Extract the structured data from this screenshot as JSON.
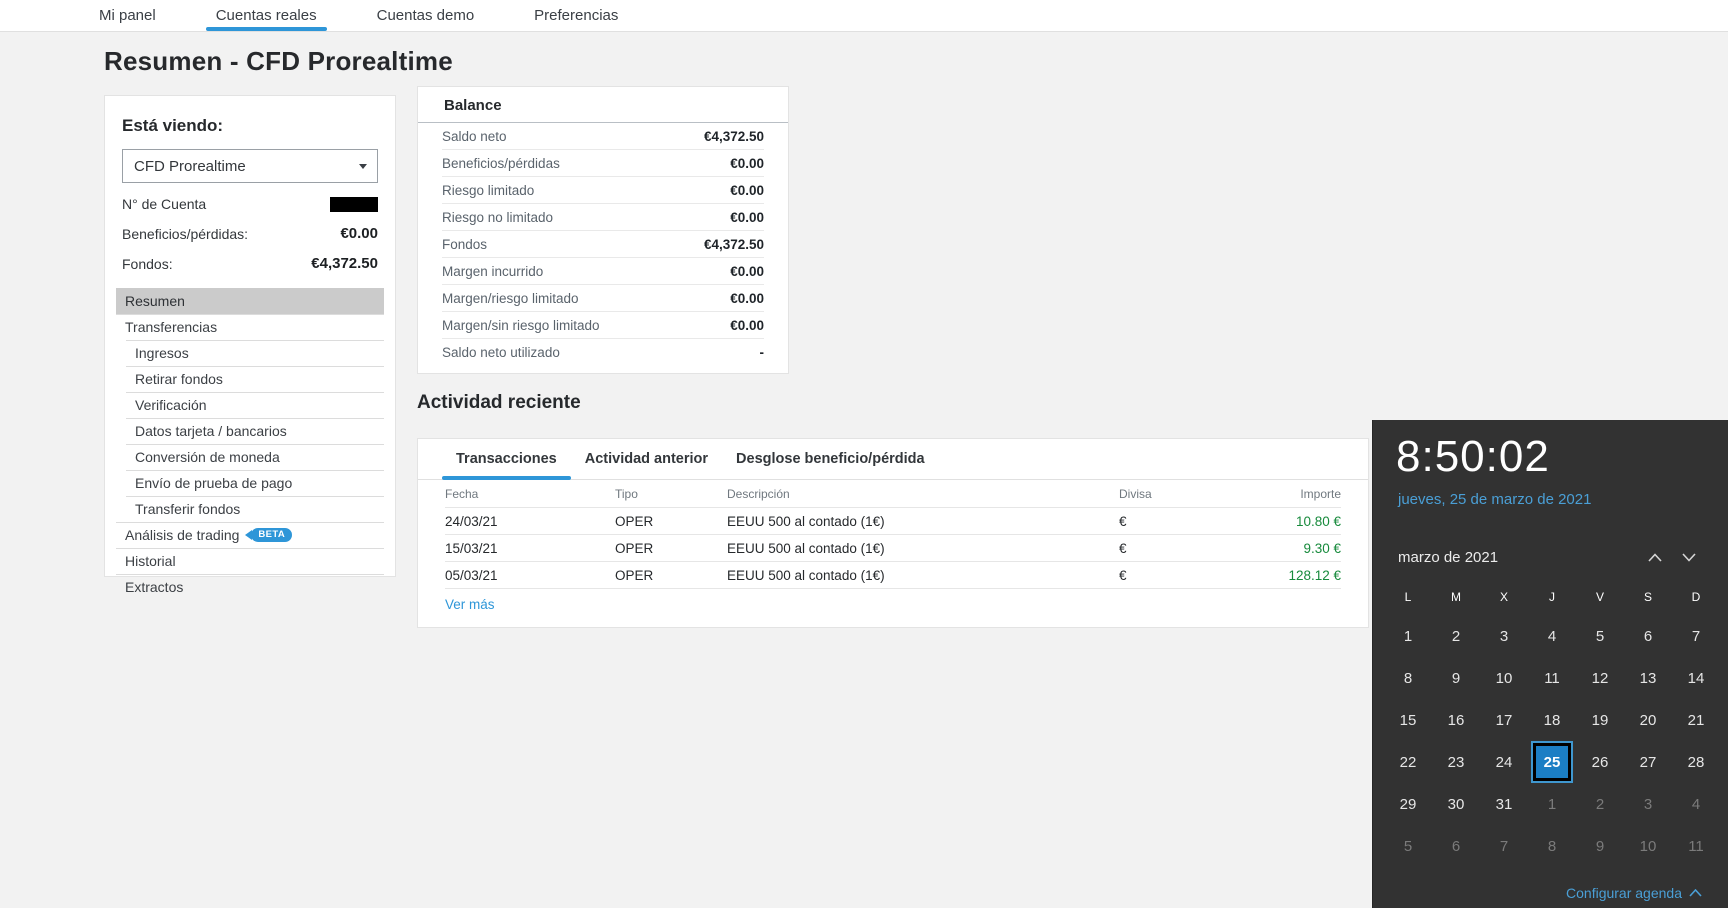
{
  "colors": {
    "accent": "#2e96d8",
    "positive": "#178a3c",
    "calendar_accent": "#4a9fd6",
    "calendar_selected_fill": "#1b7ec4",
    "sidebar_selected_bg": "#cbcbcb"
  },
  "nav": {
    "items": [
      {
        "label": "Mi panel",
        "active": false
      },
      {
        "label": "Cuentas reales",
        "active": true
      },
      {
        "label": "Cuentas demo",
        "active": false
      },
      {
        "label": "Preferencias",
        "active": false
      }
    ]
  },
  "page": {
    "title": "Resumen - CFD Prorealtime"
  },
  "account_panel": {
    "viewing_label": "Está viendo:",
    "account_select": "CFD Prorealtime",
    "account_number_label": "N° de Cuenta",
    "account_number_redacted": true,
    "pl_label": "Beneficios/pérdidas:",
    "pl_value": "€0.00",
    "funds_label": "Fondos:",
    "funds_value": "€4,372.50",
    "menu": [
      {
        "label": "Resumen",
        "selected": true,
        "sub": false
      },
      {
        "label": "Transferencias",
        "selected": false,
        "sub": false
      },
      {
        "label": "Ingresos",
        "selected": false,
        "sub": true
      },
      {
        "label": "Retirar fondos",
        "selected": false,
        "sub": true
      },
      {
        "label": "Verificación",
        "selected": false,
        "sub": true
      },
      {
        "label": "Datos tarjeta / bancarios",
        "selected": false,
        "sub": true
      },
      {
        "label": "Conversión de moneda",
        "selected": false,
        "sub": true
      },
      {
        "label": "Envío de prueba de pago",
        "selected": false,
        "sub": true
      },
      {
        "label": "Transferir fondos",
        "selected": false,
        "sub": true
      },
      {
        "label": "Análisis de trading",
        "selected": false,
        "sub": false,
        "badge": "BETA"
      },
      {
        "label": "Historial",
        "selected": false,
        "sub": false
      },
      {
        "label": "Extractos",
        "selected": false,
        "sub": false
      }
    ]
  },
  "balance": {
    "title": "Balance",
    "rows": [
      {
        "label": "Saldo neto",
        "value": "€4,372.50"
      },
      {
        "label": "Beneficios/pérdidas",
        "value": "€0.00"
      },
      {
        "label": "Riesgo limitado",
        "value": "€0.00"
      },
      {
        "label": "Riesgo no limitado",
        "value": "€0.00"
      },
      {
        "label": "Fondos",
        "value": "€4,372.50"
      },
      {
        "label": "Margen incurrido",
        "value": "€0.00"
      },
      {
        "label": "Margen/riesgo limitado",
        "value": "€0.00"
      },
      {
        "label": "Margen/sin riesgo limitado",
        "value": "€0.00"
      },
      {
        "label": "Saldo neto utilizado",
        "value": "-"
      }
    ]
  },
  "activity": {
    "title": "Actividad reciente",
    "tabs": [
      {
        "label": "Transacciones",
        "active": true
      },
      {
        "label": "Actividad anterior",
        "active": false
      },
      {
        "label": "Desglose beneficio/pérdida",
        "active": false
      }
    ],
    "table": {
      "headers": [
        "Fecha",
        "Tipo",
        "Descripción",
        "Divisa",
        "Importe"
      ],
      "rows": [
        {
          "fecha": "24/03/21",
          "tipo": "OPER",
          "descripcion": "EEUU 500 al contado (1€)",
          "divisa": "€",
          "importe": "10.80 €"
        },
        {
          "fecha": "15/03/21",
          "tipo": "OPER",
          "descripcion": "EEUU 500 al contado (1€)",
          "divisa": "€",
          "importe": "9.30 €"
        },
        {
          "fecha": "05/03/21",
          "tipo": "OPER",
          "descripcion": "EEUU 500 al contado (1€)",
          "divisa": "€",
          "importe": "128.12 €"
        }
      ]
    },
    "more_label": "Ver más"
  },
  "clock_flyout": {
    "time": "8:50:02",
    "date": "jueves, 25 de marzo de 2021",
    "month_label": "marzo de 2021",
    "day_headers": [
      "L",
      "M",
      "X",
      "J",
      "V",
      "S",
      "D"
    ],
    "selected_day": 25,
    "weeks": [
      [
        {
          "n": 1
        },
        {
          "n": 2
        },
        {
          "n": 3
        },
        {
          "n": 4
        },
        {
          "n": 5
        },
        {
          "n": 6
        },
        {
          "n": 7
        }
      ],
      [
        {
          "n": 8
        },
        {
          "n": 9
        },
        {
          "n": 10
        },
        {
          "n": 11
        },
        {
          "n": 12
        },
        {
          "n": 13
        },
        {
          "n": 14
        }
      ],
      [
        {
          "n": 15
        },
        {
          "n": 16
        },
        {
          "n": 17
        },
        {
          "n": 18
        },
        {
          "n": 19
        },
        {
          "n": 20
        },
        {
          "n": 21
        }
      ],
      [
        {
          "n": 22
        },
        {
          "n": 23
        },
        {
          "n": 24
        },
        {
          "n": 25,
          "selected": true
        },
        {
          "n": 26
        },
        {
          "n": 27
        },
        {
          "n": 28
        }
      ],
      [
        {
          "n": 29
        },
        {
          "n": 30
        },
        {
          "n": 31
        },
        {
          "n": 1,
          "muted": true
        },
        {
          "n": 2,
          "muted": true
        },
        {
          "n": 3,
          "muted": true
        },
        {
          "n": 4,
          "muted": true
        }
      ],
      [
        {
          "n": 5,
          "muted": true
        },
        {
          "n": 6,
          "muted": true
        },
        {
          "n": 7,
          "muted": true
        },
        {
          "n": 8,
          "muted": true
        },
        {
          "n": 9,
          "muted": true
        },
        {
          "n": 10,
          "muted": true
        },
        {
          "n": 11,
          "muted": true
        }
      ]
    ],
    "footer_link": "Configurar agenda"
  }
}
